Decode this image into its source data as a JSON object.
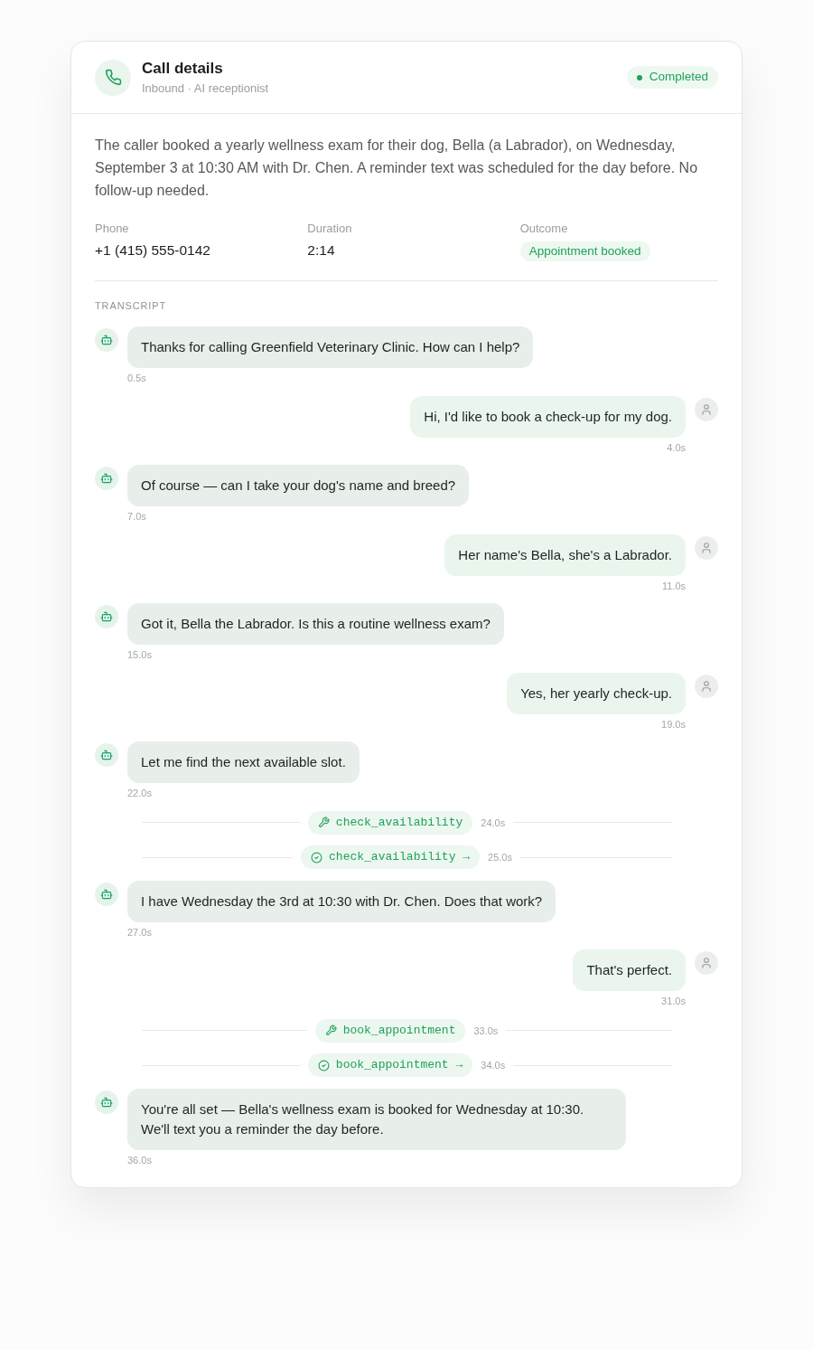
{
  "header": {
    "title": "Call details",
    "subtitle": "Inbound · AI receptionist",
    "status": "Completed"
  },
  "summary": "The caller booked a yearly wellness exam for their dog, Bella (a Labrador), on Wednesday, September 3 at 10:30 AM with Dr. Chen. A reminder text was scheduled for the day before. No follow-up needed.",
  "details": [
    {
      "label": "Phone",
      "value": "+1 (415) 555-0142",
      "kind": "text"
    },
    {
      "label": "Duration",
      "value": "2:14",
      "kind": "text"
    },
    {
      "label": "Outcome",
      "value": "Appointment booked",
      "kind": "badge"
    }
  ],
  "transcript": {
    "title": "TRANSCRIPT",
    "items": [
      {
        "kind": "agent",
        "text": "Thanks for calling Greenfield Veterinary Clinic. How can I help?",
        "time": "0.5s"
      },
      {
        "kind": "caller",
        "text": "Hi, I'd like to book a check-up for my dog.",
        "time": "4.0s"
      },
      {
        "kind": "agent",
        "text": "Of course — can I take your dog's name and breed?",
        "time": "7.0s"
      },
      {
        "kind": "caller",
        "text": "Her name's Bella, she's a Labrador.",
        "time": "11.0s"
      },
      {
        "kind": "agent",
        "text": "Got it, Bella the Labrador. Is this a routine wellness exam?",
        "time": "15.0s"
      },
      {
        "kind": "caller",
        "text": "Yes, her yearly check-up.",
        "time": "19.0s"
      },
      {
        "kind": "agent",
        "text": "Let me find the next available slot.",
        "time": "22.0s"
      },
      {
        "kind": "tool_call",
        "name": "check_availability",
        "time": "24.0s"
      },
      {
        "kind": "tool_result",
        "name": "check_availability →",
        "time": "25.0s"
      },
      {
        "kind": "agent",
        "text": "I have Wednesday the 3rd at 10:30 with Dr. Chen. Does that work?",
        "time": "27.0s"
      },
      {
        "kind": "caller",
        "text": "That's perfect.",
        "time": "31.0s"
      },
      {
        "kind": "tool_call",
        "name": "book_appointment",
        "time": "33.0s"
      },
      {
        "kind": "tool_result",
        "name": "book_appointment →",
        "time": "34.0s"
      },
      {
        "kind": "agent",
        "text": "You're all set — Bella's wellness exam is booked for Wednesday at 10:30. We'll text you a reminder the day before.",
        "time": "36.0s"
      }
    ]
  }
}
